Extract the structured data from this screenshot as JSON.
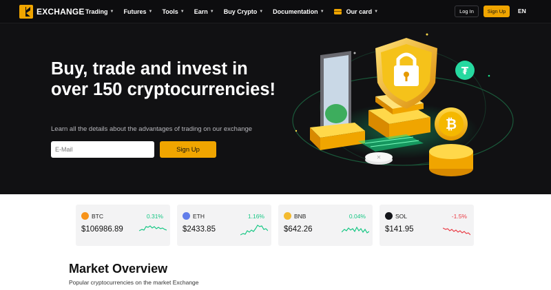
{
  "nav": {
    "brand": "EXCHANGE",
    "items": [
      {
        "label": "Trading"
      },
      {
        "label": "Futures"
      },
      {
        "label": "Tools"
      },
      {
        "label": "Earn"
      },
      {
        "label": "Buy Crypto"
      },
      {
        "label": "Documentation"
      },
      {
        "label": "Our card"
      }
    ],
    "login_label": "Log In",
    "signup_label": "Sign Up",
    "language": "EN"
  },
  "hero": {
    "headline": "Buy, trade and invest in over 150 cryptocurrencies!",
    "subtitle": "Learn all the details about the advantages of trading on our exchange",
    "email_placeholder": "E-Mail",
    "signup_label": "Sign Up"
  },
  "tickers": [
    {
      "symbol": "BTC",
      "change": "0.31%",
      "price": "$106986.89",
      "trend": "up",
      "icon": "bitcoin-icon",
      "color": "#f7931a"
    },
    {
      "symbol": "ETH",
      "change": "1.16%",
      "price": "$2433.85",
      "trend": "up",
      "icon": "ethereum-icon",
      "color": "#627eea"
    },
    {
      "symbol": "BNB",
      "change": "0.04%",
      "price": "$642.26",
      "trend": "up",
      "icon": "bnb-icon",
      "color": "#f3ba2f"
    },
    {
      "symbol": "SOL",
      "change": "-1.5%",
      "price": "$141.95",
      "trend": "down",
      "icon": "solana-icon",
      "color": "#14151a"
    }
  ],
  "market_overview": {
    "title": "Market Overview",
    "subtitle": "Popular cryptocurrencies on the market Exchange"
  },
  "colors": {
    "accent": "#f0a500",
    "positive": "#16c784",
    "negative": "#ea3943",
    "hero_bg": "#111113"
  }
}
